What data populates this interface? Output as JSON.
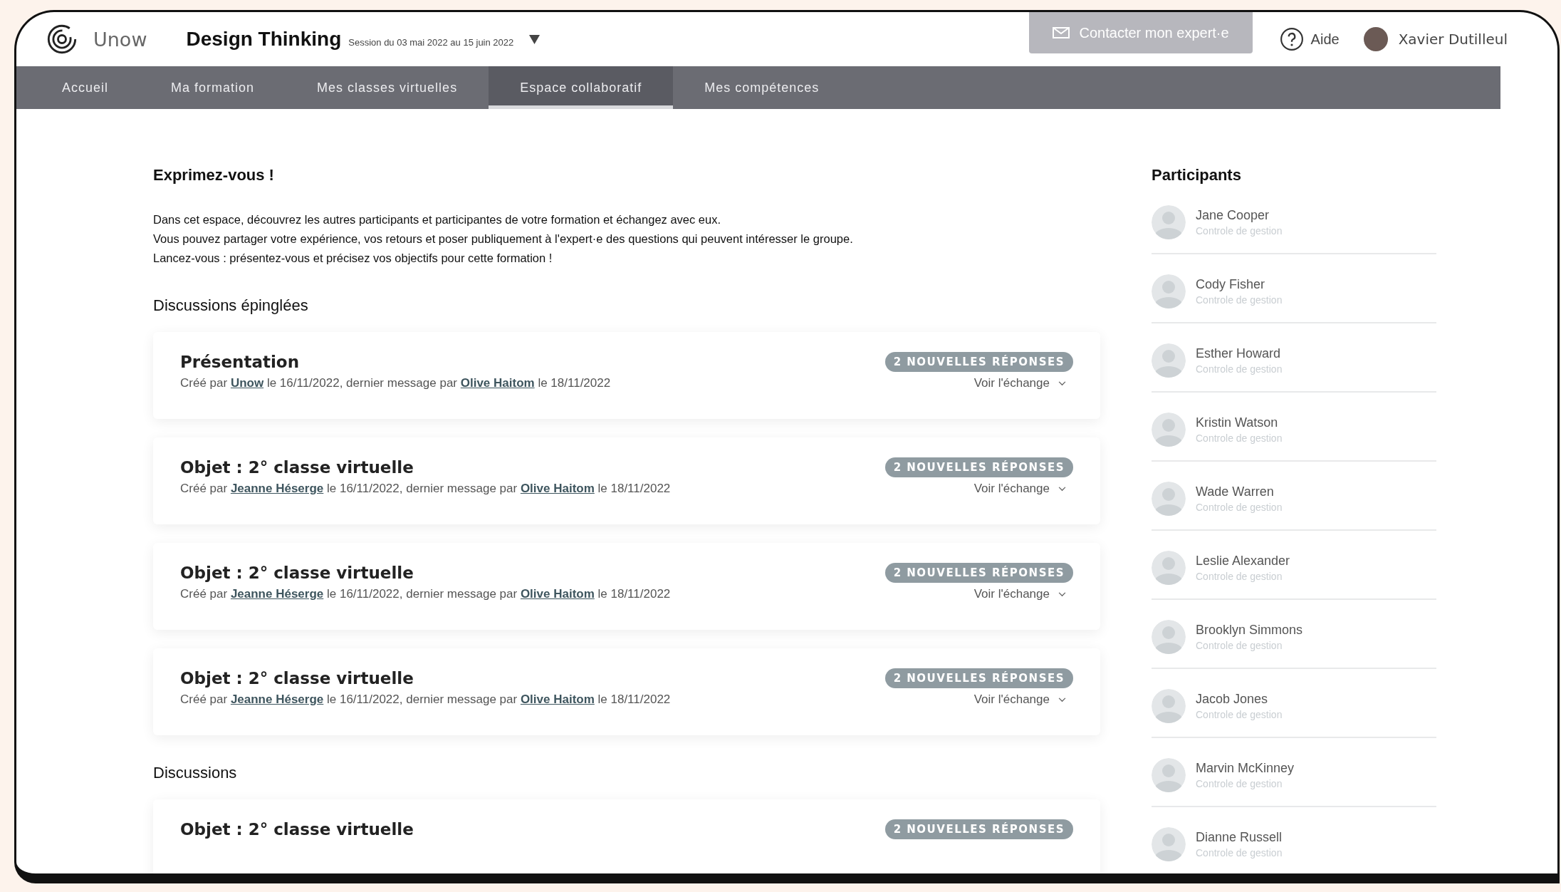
{
  "header": {
    "logo_text": "Unow",
    "course_title": "Design Thinking",
    "session": "Session du 03 mai 2022 au 15 juin 2022",
    "contact_button": "Contacter mon expert·e",
    "help": "Aide",
    "user_name": "Xavier Dutilleul"
  },
  "tabs": [
    {
      "label": "Accueil",
      "selected": false
    },
    {
      "label": "Ma formation",
      "selected": false
    },
    {
      "label": "Mes classes virtuelles",
      "selected": false
    },
    {
      "label": "Espace collaboratif",
      "selected": true
    },
    {
      "label": "Mes compétences",
      "selected": false
    }
  ],
  "intro": {
    "title": "Exprimez-vous !",
    "lines": [
      "Dans cet espace, découvrez les autres participants et participantes de votre formation et échangez avec eux.",
      "Vous pouvez partager votre expérience, vos retours et poser publiquement à l'expert·e des questions qui peuvent intéresser le groupe.",
      "Lancez-vous : présentez-vous et précisez vos objectifs pour cette formation !"
    ]
  },
  "sections": [
    {
      "title": "Discussions épinglées",
      "discussions": [
        {
          "title": "Présentation",
          "badge": "2 NOUVELLES RÉPONSES",
          "meta": {
            "created_by_label": "Créé par",
            "author": "Unow",
            "created": "le 16/11/2022, dernier message par",
            "last_author": "Olive Haitom",
            "last_date": "le 18/11/2022"
          },
          "action": "Voir l'échange"
        },
        {
          "title": "Objet : 2° classe virtuelle",
          "badge": "2 NOUVELLES RÉPONSES",
          "meta": {
            "created_by_label": "Créé par",
            "author": "Jeanne Héserge",
            "created": "le 16/11/2022, dernier message par",
            "last_author": "Olive Haitom",
            "last_date": "le 18/11/2022"
          },
          "action": "Voir l'échange"
        },
        {
          "title": "Objet : 2° classe virtuelle",
          "badge": "2 NOUVELLES RÉPONSES",
          "meta": {
            "created_by_label": "Créé par",
            "author": "Jeanne Héserge",
            "created": "le 16/11/2022, dernier message par",
            "last_author": "Olive Haitom",
            "last_date": "le 18/11/2022"
          },
          "action": "Voir l'échange"
        },
        {
          "title": "Objet : 2° classe virtuelle",
          "badge": "2 NOUVELLES RÉPONSES",
          "meta": {
            "created_by_label": "Créé par",
            "author": "Jeanne Héserge",
            "created": "le 16/11/2022, dernier message par",
            "last_author": "Olive Haitom",
            "last_date": "le 18/11/2022"
          },
          "action": "Voir l'échange"
        }
      ]
    },
    {
      "title": "Discussions",
      "discussions": [
        {
          "title": "Objet : 2° classe virtuelle",
          "badge": "2 NOUVELLES RÉPONSES"
        }
      ]
    }
  ],
  "participants": {
    "title": "Participants",
    "people": [
      {
        "name": "Jane Cooper",
        "role": "Controle de gestion"
      },
      {
        "name": "Cody Fisher",
        "role": "Controle de gestion"
      },
      {
        "name": "Esther Howard",
        "role": "Controle de gestion"
      },
      {
        "name": "Kristin Watson",
        "role": "Controle de gestion"
      },
      {
        "name": "Wade Warren",
        "role": "Controle de gestion"
      },
      {
        "name": "Leslie Alexander",
        "role": "Controle de gestion"
      },
      {
        "name": "Brooklyn Simmons",
        "role": "Controle de gestion"
      },
      {
        "name": "Jacob Jones",
        "role": "Controle de gestion"
      },
      {
        "name": "Marvin McKinney",
        "role": "Controle de gestion"
      },
      {
        "name": "Dianne Russell",
        "role": "Controle de gestion"
      }
    ]
  }
}
